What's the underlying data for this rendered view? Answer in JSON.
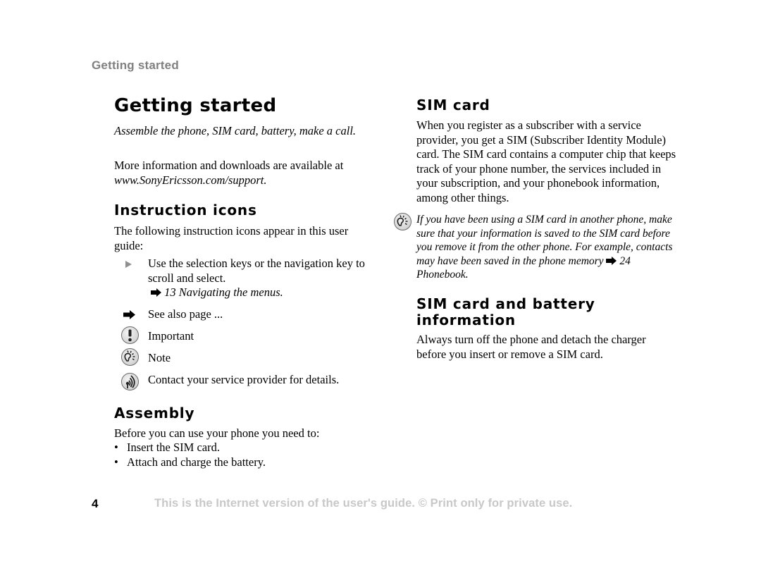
{
  "running_head": "Getting started",
  "left_column": {
    "title": "Getting started",
    "intro_italic": "Assemble the phone, SIM card, battery, make a call.",
    "more_info_prefix": "More information and downloads are available at ",
    "more_info_link": "www.SonyEricsson.com/support.",
    "instruction_icons": {
      "heading": "Instruction icons",
      "intro": "The following instruction icons appear in this user guide:",
      "items": [
        {
          "icon": "triangle-right-icon",
          "text": "Use the selection keys or the navigation key to scroll and select.",
          "reference": "13 Navigating the menus."
        },
        {
          "icon": "see-also-arrow-icon",
          "text": "See also page ..."
        },
        {
          "icon": "important-icon",
          "text": "Important"
        },
        {
          "icon": "note-icon",
          "text": "Note"
        },
        {
          "icon": "operator-icon",
          "text": "Contact your service provider for details."
        }
      ]
    },
    "assembly": {
      "heading": "Assembly",
      "intro": "Before you can use your phone you need to:",
      "bullets": [
        "Insert the SIM card.",
        "Attach and charge the battery."
      ]
    }
  },
  "right_column": {
    "sim_card": {
      "heading": "SIM card",
      "body": "When you register as a subscriber with a service provider, you get a SIM (Subscriber Identity Module) card. The SIM card contains a computer chip that keeps track of your phone number, the services included in your subscription, and your phonebook information, among other things.",
      "note": "If you have been using a SIM card in another phone, make sure that your information is saved to the SIM card before you remove it from the other phone. For example, contacts may have been saved in the phone memory",
      "note_reference": "24 Phonebook."
    },
    "sim_battery": {
      "heading": "SIM card and battery information",
      "body": "Always turn off the phone and detach the charger before you insert or remove a SIM card."
    }
  },
  "footer": {
    "page_number": "4",
    "notice": "This is the Internet version of the user's guide. © Print only for private use."
  }
}
